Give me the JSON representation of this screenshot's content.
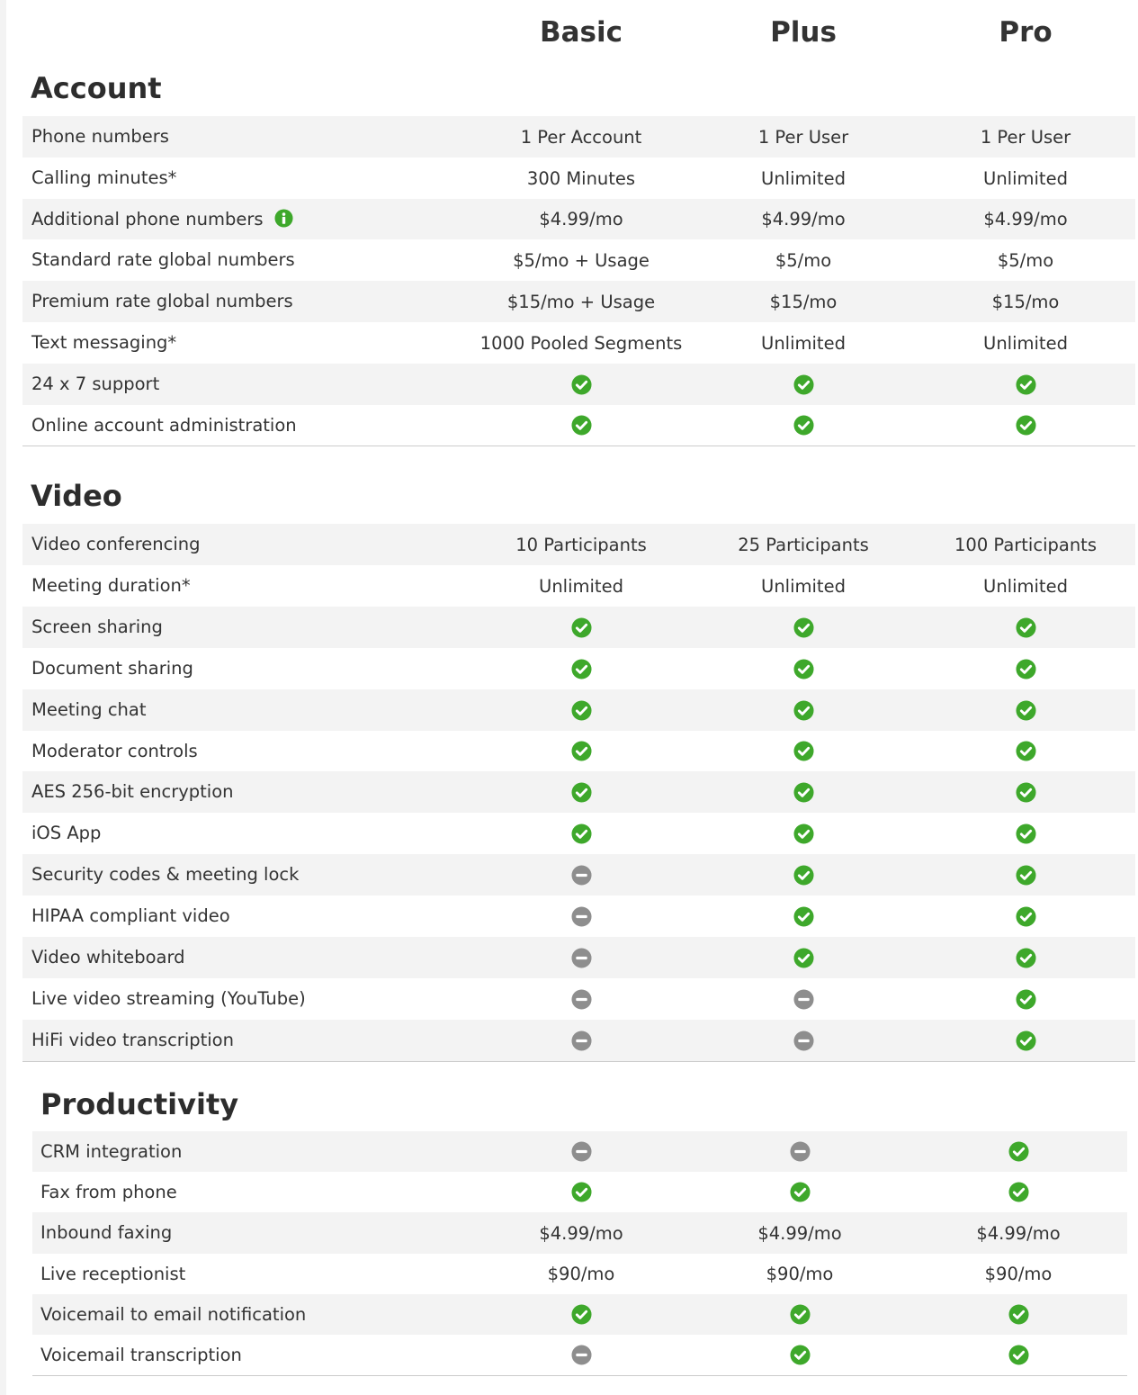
{
  "plans": [
    "Basic",
    "Plus",
    "Pro"
  ],
  "colors": {
    "check": "#3ea82b",
    "minus": "#8e8e8e",
    "info": "#3ea82b",
    "row_shade": "#f3f3f3"
  },
  "sections": [
    {
      "title": "Account",
      "rows": [
        {
          "label": "Phone numbers",
          "values": [
            "1 Per Account",
            "1 Per User",
            "1 Per User"
          ]
        },
        {
          "label": "Calling minutes*",
          "values": [
            "300 Minutes",
            "Unlimited",
            "Unlimited"
          ]
        },
        {
          "label": "Additional phone numbers",
          "info_icon": true,
          "values": [
            "$4.99/mo",
            "$4.99/mo",
            "$4.99/mo"
          ]
        },
        {
          "label": "Standard rate global numbers",
          "values": [
            "$5/mo + Usage",
            "$5/mo",
            "$5/mo"
          ]
        },
        {
          "label": "Premium rate global numbers",
          "values": [
            "$15/mo + Usage",
            "$15/mo",
            "$15/mo"
          ]
        },
        {
          "label": "Text messaging*",
          "values": [
            "1000 Pooled Segments",
            "Unlimited",
            "Unlimited"
          ]
        },
        {
          "label": "24 x 7 support",
          "values": [
            "check-icon",
            "check-icon",
            "check-icon"
          ]
        },
        {
          "label": "Online account administration",
          "values": [
            "check-icon",
            "check-icon",
            "check-icon"
          ]
        }
      ]
    },
    {
      "title": "Video",
      "rows": [
        {
          "label": "Video conferencing",
          "values": [
            "10 Participants",
            "25 Participants",
            "100 Participants"
          ]
        },
        {
          "label": "Meeting duration*",
          "values": [
            "Unlimited",
            "Unlimited",
            "Unlimited"
          ]
        },
        {
          "label": "Screen sharing",
          "values": [
            "check-icon",
            "check-icon",
            "check-icon"
          ]
        },
        {
          "label": "Document sharing",
          "values": [
            "check-icon",
            "check-icon",
            "check-icon"
          ]
        },
        {
          "label": "Meeting chat",
          "values": [
            "check-icon",
            "check-icon",
            "check-icon"
          ]
        },
        {
          "label": "Moderator controls",
          "values": [
            "check-icon",
            "check-icon",
            "check-icon"
          ]
        },
        {
          "label": "AES 256-bit encryption",
          "values": [
            "check-icon",
            "check-icon",
            "check-icon"
          ]
        },
        {
          "label": "iOS App",
          "values": [
            "check-icon",
            "check-icon",
            "check-icon"
          ]
        },
        {
          "label": "Security codes & meeting lock",
          "values": [
            "minus-icon",
            "check-icon",
            "check-icon"
          ]
        },
        {
          "label": "HIPAA compliant video",
          "values": [
            "minus-icon",
            "check-icon",
            "check-icon"
          ]
        },
        {
          "label": "Video whiteboard",
          "values": [
            "minus-icon",
            "check-icon",
            "check-icon"
          ]
        },
        {
          "label": "Live video streaming (YouTube)",
          "values": [
            "minus-icon",
            "minus-icon",
            "check-icon"
          ]
        },
        {
          "label": "HiFi video transcription",
          "values": [
            "minus-icon",
            "minus-icon",
            "check-icon"
          ]
        }
      ]
    },
    {
      "title": "Productivity",
      "rows": [
        {
          "label": "CRM integration",
          "values": [
            "minus-icon",
            "minus-icon",
            "check-icon"
          ]
        },
        {
          "label": "Fax from phone",
          "values": [
            "check-icon",
            "check-icon",
            "check-icon"
          ]
        },
        {
          "label": "Inbound faxing",
          "values": [
            "$4.99/mo",
            "$4.99/mo",
            "$4.99/mo"
          ]
        },
        {
          "label": "Live receptionist",
          "values": [
            "$90/mo",
            "$90/mo",
            "$90/mo"
          ]
        },
        {
          "label": "Voicemail to email notification",
          "values": [
            "check-icon",
            "check-icon",
            "check-icon"
          ]
        },
        {
          "label": "Voicemail transcription",
          "values": [
            "minus-icon",
            "check-icon",
            "check-icon"
          ]
        }
      ]
    }
  ]
}
